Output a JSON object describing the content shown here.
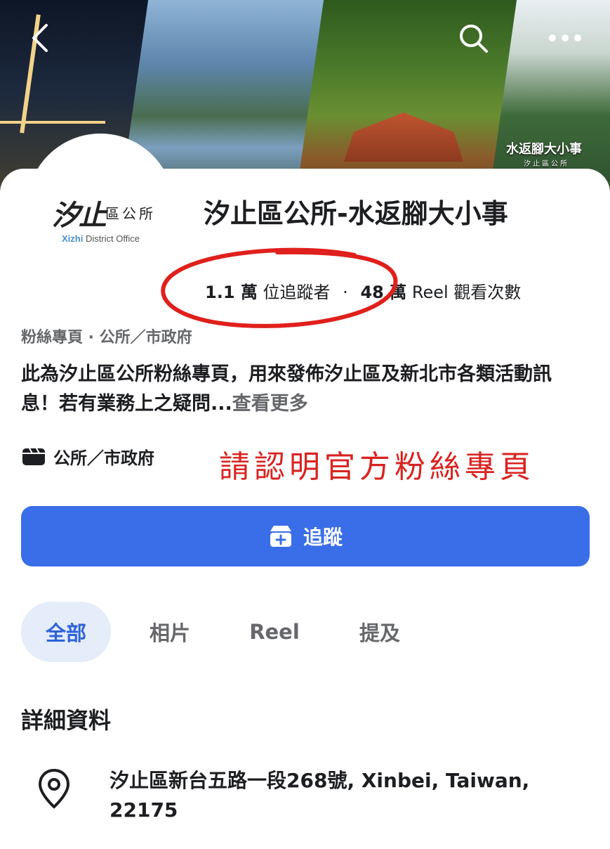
{
  "cover": {
    "caption": "水返腳大小事",
    "sub": "汐止區公所",
    "back_icon": "back-arrow-icon",
    "search_icon": "search-icon",
    "more_icon": "more-horizontal-icon"
  },
  "profile": {
    "logo_main": "汐止",
    "logo_side": "區公所",
    "logo_en_highlight": "Xizhi",
    "logo_en_rest": " District Office",
    "title": "汐止區公所-水返腳大小事",
    "followers_count": "1.1 萬",
    "followers_label": "位追蹤者",
    "separator": "·",
    "reel_views_count": "48 萬",
    "reel_views_label": "Reel 觀看次數",
    "category": "粉絲專頁 · 公所／市政府",
    "bio": "此為汐止區公所粉絲專頁，用來發佈汐止區及新北市各類活動訊息！若有業務上之疑問...",
    "see_more": "查看更多",
    "page_type": "公所／市政府",
    "page_type_icon": "clapperboard-icon",
    "annotation": "請認明官方粉絲專頁",
    "annotation_color": "#d92320"
  },
  "actions": {
    "follow_label": "追蹤",
    "follow_icon": "follow-page-icon",
    "accent": "#3a6ee8"
  },
  "tabs": [
    {
      "label": "全部",
      "active": true
    },
    {
      "label": "相片",
      "active": false
    },
    {
      "label": "Reel",
      "active": false
    },
    {
      "label": "提及",
      "active": false
    }
  ],
  "details": {
    "title": "詳細資料",
    "address_icon": "location-pin-icon",
    "address": "汐止區新台五路一段268號, Xinbei, Taiwan, 22175"
  }
}
